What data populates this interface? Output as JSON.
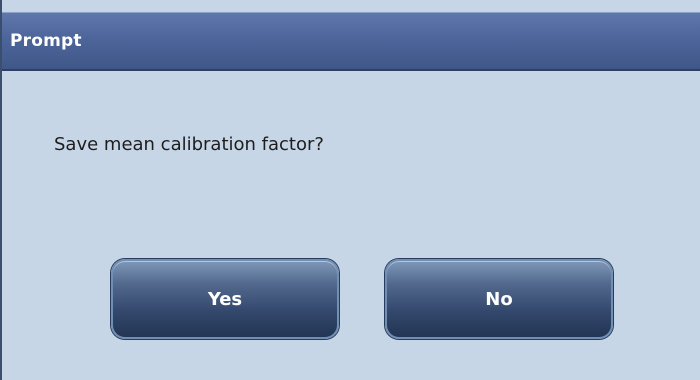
{
  "dialog": {
    "title": "Prompt",
    "message": "Save mean calibration factor?",
    "buttons": {
      "yes_label": "Yes",
      "no_label": "No"
    }
  },
  "colors": {
    "titlebar": "#4d659a",
    "background": "#c7d6e6",
    "button": "#34496d",
    "title_text": "#ffffff",
    "message_text": "#1d1d1d"
  }
}
